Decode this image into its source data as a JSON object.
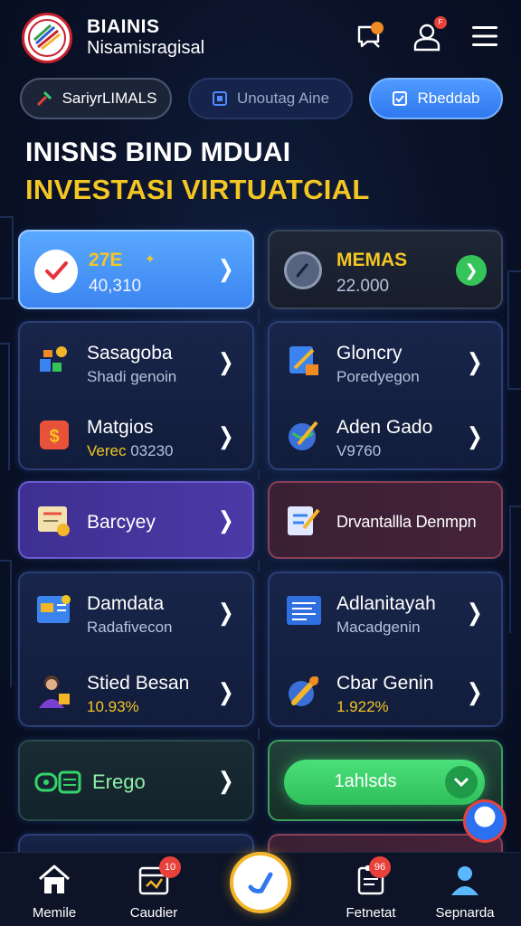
{
  "header": {
    "brand_line1": "BIAINIS",
    "brand_line2": "Nisamisragisal",
    "notification_badge": "",
    "profile_badge": "F"
  },
  "pills": [
    {
      "label": "SariyrLIMALS"
    },
    {
      "label": "Unoutag Aine"
    },
    {
      "label": "Rbeddab"
    }
  ],
  "titles": {
    "line1": "INISNS BIND MDUAI",
    "line2": "INVESTASI VIRTUATCIAL"
  },
  "cards": {
    "top_left": {
      "title": "27E",
      "subtitle": "40,310"
    },
    "top_right": {
      "title": "MEMAS",
      "subtitle": "22.000"
    },
    "left_group1": [
      {
        "title": "Sasagoba",
        "subtitle": "Shadi genoin",
        "icon": "tools-icon"
      },
      {
        "title": "Matgios",
        "subtitle_gold": "Verec",
        "subtitle": "03230",
        "icon": "coin-icon"
      }
    ],
    "right_group1": [
      {
        "title": "Gloncry",
        "subtitle": "Poredyegon",
        "icon": "document-icon"
      },
      {
        "title": "Aden Gado",
        "subtitle": "V9760",
        "icon": "globe-icon"
      }
    ],
    "left_single": {
      "title": "Barcyey",
      "icon": "certificate-icon"
    },
    "right_single": {
      "title": "Drvantallla Denmpn",
      "icon": "report-icon"
    },
    "left_group2": [
      {
        "title": "Damdata",
        "subtitle": "Radafivecon",
        "icon": "chart-window-icon"
      },
      {
        "title": "Stied Besan",
        "subtitle": "10.93%",
        "icon": "person-icon"
      }
    ],
    "right_group2": [
      {
        "title": "Adlanitayah",
        "subtitle": "Macadgenin",
        "icon": "dashboard-icon"
      },
      {
        "title": "Cbar Genin",
        "subtitle": "1.922%",
        "icon": "wrench-globe-icon"
      }
    ],
    "bottom_left": {
      "title": "Erego",
      "icon": "wallet-icon"
    },
    "bottom_right": {
      "button_label": "1ahlsds"
    }
  },
  "bottom_nav": [
    {
      "label": "Memile",
      "icon": "home-icon",
      "badge": ""
    },
    {
      "label": "Caudier",
      "icon": "calendar-icon",
      "badge": "10"
    },
    {
      "label": "",
      "icon": "center-action-icon",
      "badge": ""
    },
    {
      "label": "Fetnetat",
      "icon": "clipboard-icon",
      "badge": "96"
    },
    {
      "label": "Sepnarda",
      "icon": "user-icon",
      "badge": ""
    }
  ],
  "colors": {
    "background": "#0a1228",
    "accent_gold": "#f3c623",
    "accent_blue": "#3b84f0",
    "badge_red": "#e8413a",
    "success_green": "#35c45a"
  }
}
